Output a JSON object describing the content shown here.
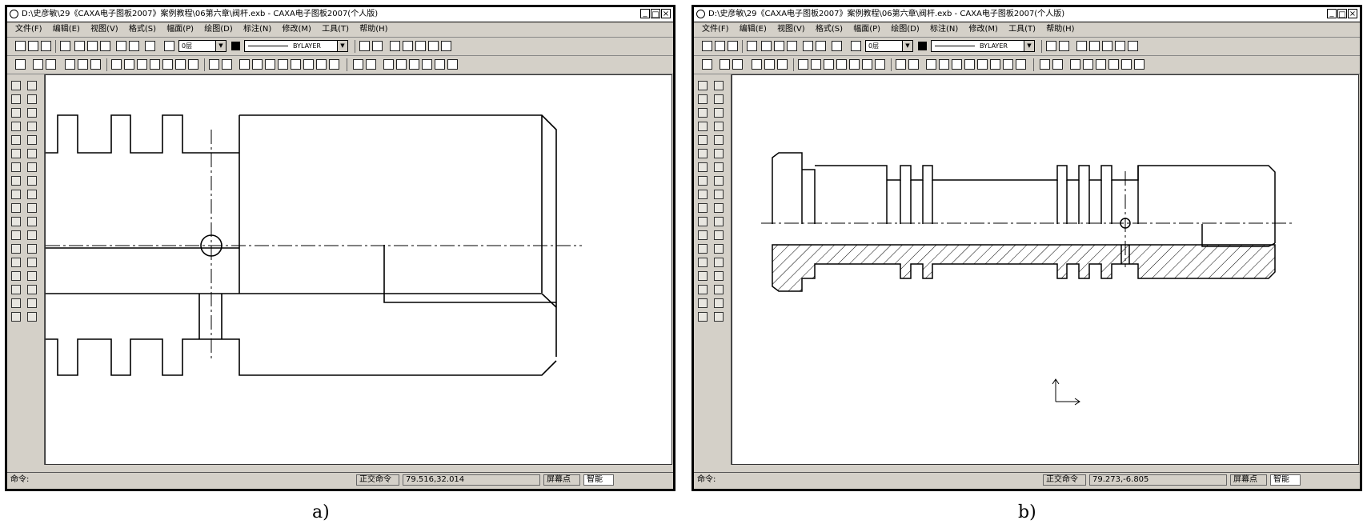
{
  "windows": {
    "a": {
      "title": "D:\\史彦敏\\29《CAXA电子图板2007》案例教程\\06第六章\\阀杆.exb - CAXA电子图板2007(个人版)",
      "menu": [
        "文件(F)",
        "编辑(E)",
        "视图(V)",
        "格式(S)",
        "幅面(P)",
        "绘图(D)",
        "标注(N)",
        "修改(M)",
        "工具(T)",
        "帮助(H)"
      ],
      "layer_value": "0层",
      "linetype_value": "BYLAYER",
      "status": {
        "command_label": "命令:",
        "mode_label": "正交命令",
        "coords": "79.516,32.014",
        "snap_label": "屏幕点",
        "smart_label": "智能"
      }
    },
    "b": {
      "title": "D:\\史彦敏\\29《CAXA电子图板2007》案例教程\\06第六章\\阀杆.exb - CAXA电子图板2007(个人版)",
      "menu": [
        "文件(F)",
        "编辑(E)",
        "视图(V)",
        "格式(S)",
        "幅面(P)",
        "绘图(D)",
        "标注(N)",
        "修改(M)",
        "工具(T)",
        "帮助(H)"
      ],
      "layer_value": "0层",
      "linetype_value": "BYLAYER",
      "status": {
        "command_label": "命令:",
        "mode_label": "正交命令",
        "coords": "79.273,-6.805",
        "snap_label": "屏幕点",
        "smart_label": "智能"
      }
    }
  },
  "captions": {
    "a": "a)",
    "b": "b)"
  },
  "colors": {
    "background": "#d4d0c8",
    "canvas": "#ffffff",
    "lines": "#000000"
  }
}
